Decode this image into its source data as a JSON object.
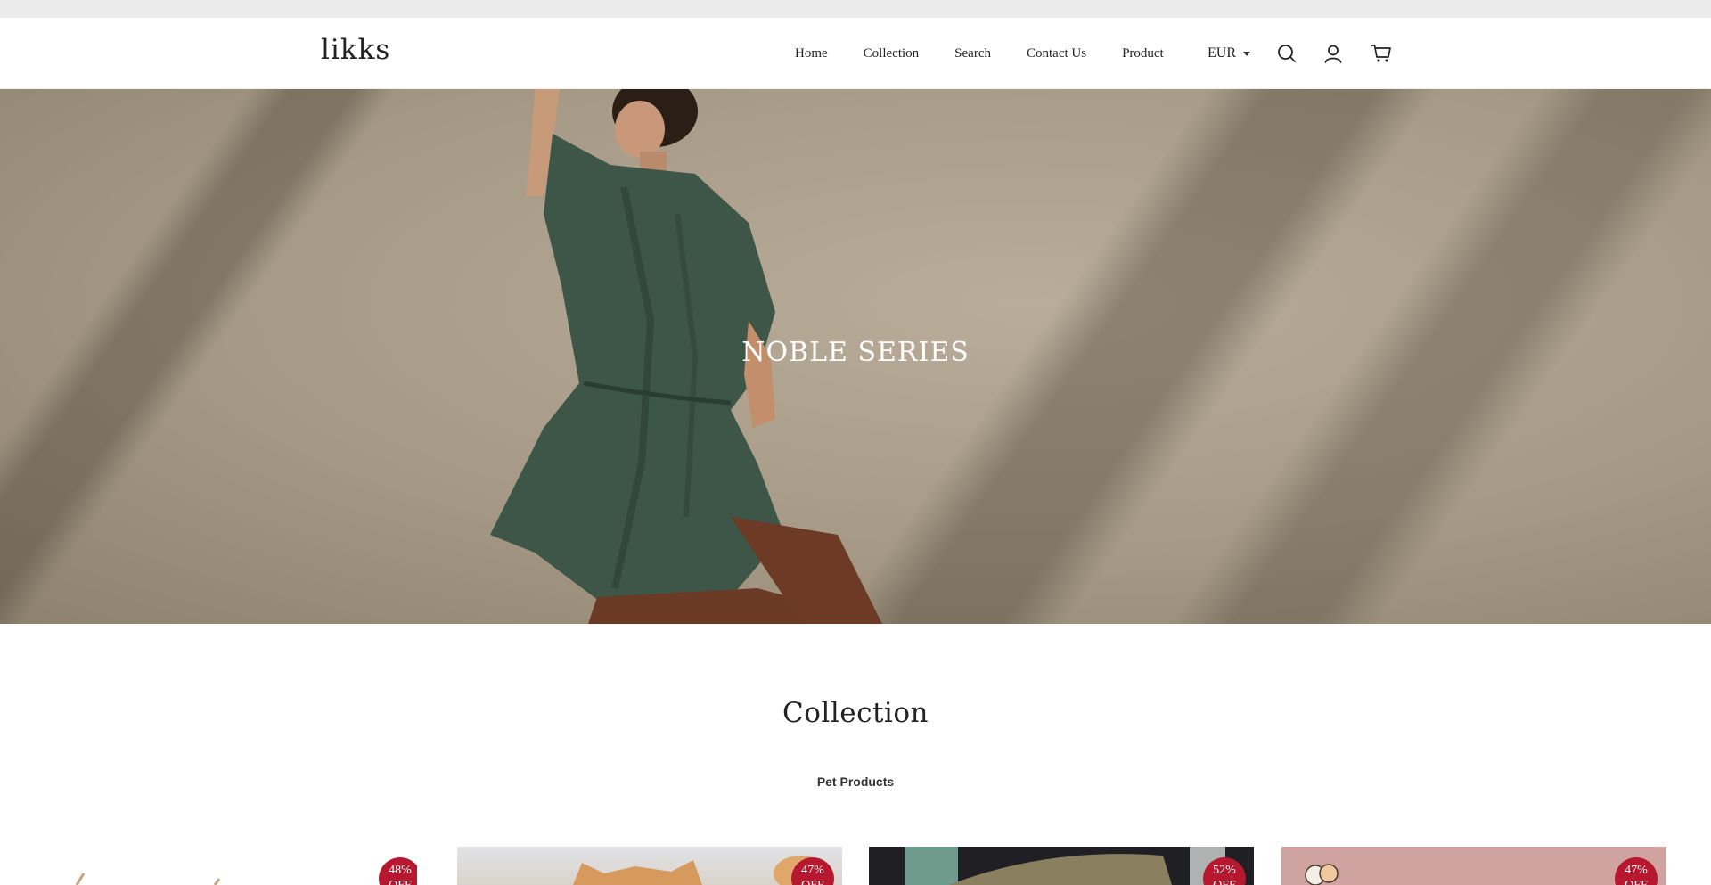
{
  "header": {
    "logo": "likks",
    "nav": [
      "Home",
      "Collection",
      "Search",
      "Contact Us",
      "Product"
    ],
    "currency": "EUR",
    "icons": [
      "search-icon",
      "account-icon",
      "cart-icon"
    ]
  },
  "hero": {
    "title": "NOBLE SERIES"
  },
  "collection": {
    "title": "Collection",
    "tab": "Pet Products",
    "products": [
      {
        "badge_line1": "48%",
        "badge_line2": "OFF"
      },
      {
        "badge_line1": "47%",
        "badge_line2": "OFF"
      },
      {
        "badge_line1": "52%",
        "badge_line2": "OFF"
      },
      {
        "badge_line1": "47%",
        "badge_line2": "OFF"
      }
    ]
  },
  "colors": {
    "topbar": "#ebebeb",
    "badge": "#b5182f",
    "text": "#222222"
  }
}
